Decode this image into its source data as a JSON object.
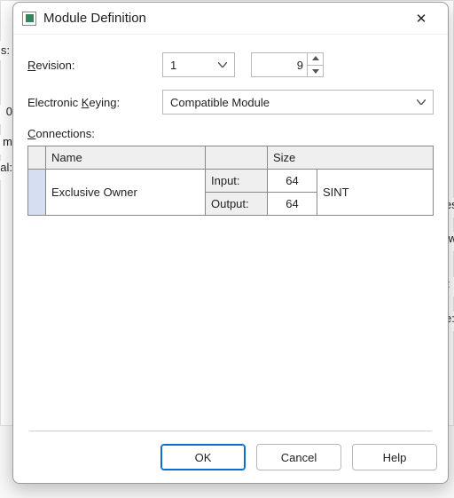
{
  "titlebar": {
    "title": "Module Definition",
    "close_glyph": "✕"
  },
  "fields": {
    "revision_label_pre": "R",
    "revision_label_mid": "evision:",
    "revision_major": "1",
    "revision_minor": "9",
    "keying_label_pre": "Electronic ",
    "keying_label_u": "K",
    "keying_label_post": "eying:",
    "keying_value": "Compatible Module",
    "connections_label_pre": "C",
    "connections_label_post": "onnections:"
  },
  "table": {
    "header_name": "Name",
    "header_size": "Size",
    "rows": [
      {
        "name": "Exclusive Owner",
        "dir_in_label": "Input:",
        "dir_in_size": "64",
        "dir_out_label": "Output:",
        "dir_out_size": "64",
        "datatype": "SINT"
      }
    ]
  },
  "buttons": {
    "ok": "OK",
    "cancel": "Cancel",
    "help": "Help"
  }
}
